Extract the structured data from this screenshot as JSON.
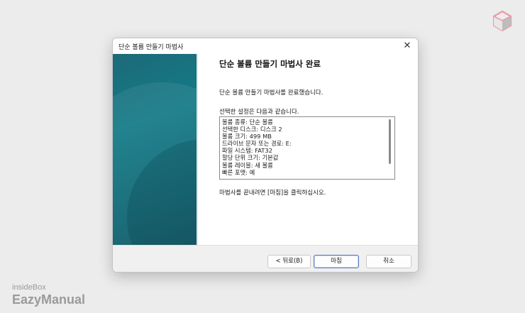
{
  "window": {
    "title": "단순 볼륨 만들기 마법사",
    "close_glyph": "✕"
  },
  "main": {
    "heading": "단순 볼륨 만들기 마법사 완료",
    "completed_text": "단순 볼륨 만들기 마법사를 완료했습니다.",
    "settings_label": "선택한 설정은 다음과 같습니다.",
    "settings": [
      "볼륨 종류: 단순 볼륨",
      "선택한 디스크: 디스크 2",
      "볼륨 크기: 499 MB",
      "드라이브 문자 또는 경로: E:",
      "파일 시스템: FAT32",
      "할당 단위 크기: 기본값",
      "볼륨 레이블: 새 볼륨",
      "빠른 포맷: 예"
    ],
    "finish_hint": "마법사를 끝내려면 [마침]을 클릭하십시오."
  },
  "footer": {
    "back_label": "< 뒤로(B)",
    "finish_label": "마침",
    "cancel_label": "취소"
  },
  "branding": {
    "line1": "insideBox",
    "line2": "EazyManual"
  },
  "icons": {
    "corner_logo": "cube-logo-icon",
    "close": "close-icon"
  },
  "colors": {
    "side_graphic": "#137a87",
    "finish_border": "#5b7fbf",
    "logo_pink": "#e89aa8"
  }
}
